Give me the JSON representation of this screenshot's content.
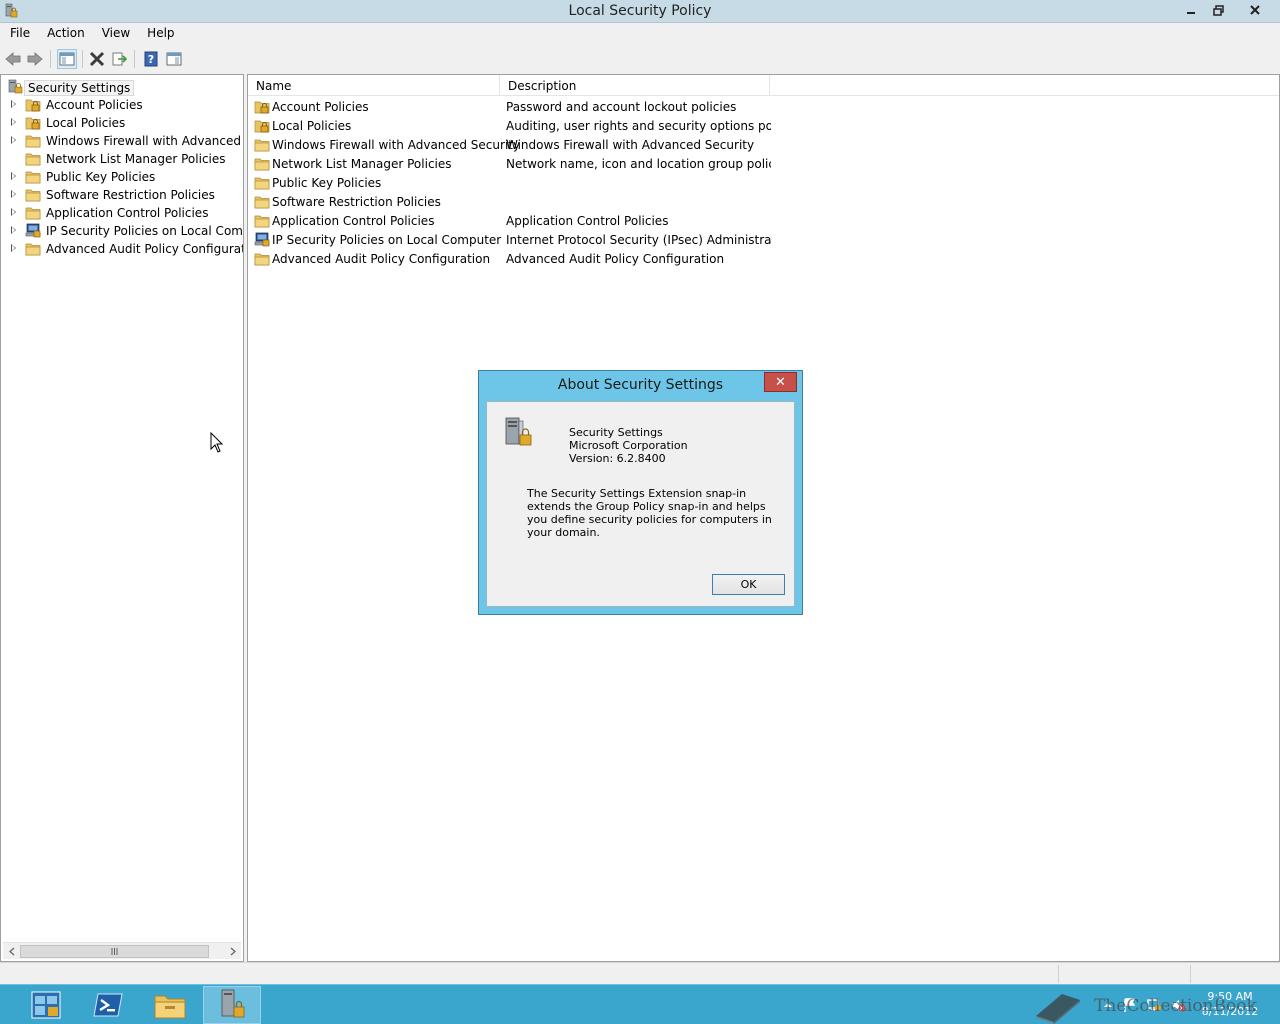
{
  "window": {
    "title": "Local Security Policy"
  },
  "menu": [
    {
      "label": "File"
    },
    {
      "label": "Action"
    },
    {
      "label": "View"
    },
    {
      "label": "Help"
    }
  ],
  "tree": {
    "root": "Security Settings",
    "items": [
      {
        "label": "Account Policies",
        "icon": "folder-lock-icon",
        "expandable": true
      },
      {
        "label": "Local Policies",
        "icon": "folder-lock-icon",
        "expandable": true
      },
      {
        "label": "Windows Firewall with Advanced Security",
        "icon": "folder-icon",
        "expandable": true
      },
      {
        "label": "Network List Manager Policies",
        "icon": "folder-icon",
        "expandable": false
      },
      {
        "label": "Public Key Policies",
        "icon": "folder-icon",
        "expandable": true
      },
      {
        "label": "Software Restriction Policies",
        "icon": "folder-icon",
        "expandable": true
      },
      {
        "label": "Application Control Policies",
        "icon": "folder-icon",
        "expandable": true
      },
      {
        "label": "IP Security Policies on Local Computer",
        "icon": "ipsec-icon",
        "expandable": true
      },
      {
        "label": "Advanced Audit Policy Configuration",
        "icon": "folder-icon",
        "expandable": true
      }
    ]
  },
  "list": {
    "columns": {
      "name": "Name",
      "description": "Description"
    },
    "rows": [
      {
        "name": "Account Policies",
        "description": "Password and account lockout policies",
        "icon": "folder-lock-icon"
      },
      {
        "name": "Local Policies",
        "description": "Auditing, user rights and security options polici...",
        "icon": "folder-lock-icon"
      },
      {
        "name": "Windows Firewall with Advanced Security",
        "description": "Windows Firewall with Advanced Security",
        "icon": "folder-icon"
      },
      {
        "name": "Network List Manager Policies",
        "description": "Network name, icon and location group policies.",
        "icon": "folder-icon"
      },
      {
        "name": "Public Key Policies",
        "description": "",
        "icon": "folder-icon"
      },
      {
        "name": "Software Restriction Policies",
        "description": "",
        "icon": "folder-icon"
      },
      {
        "name": "Application Control Policies",
        "description": "Application Control Policies",
        "icon": "folder-icon"
      },
      {
        "name": "IP Security Policies on Local Computer",
        "description": "Internet Protocol Security (IPsec) Administratio...",
        "icon": "ipsec-icon"
      },
      {
        "name": "Advanced Audit Policy Configuration",
        "description": "Advanced Audit Policy Configuration",
        "icon": "folder-icon"
      }
    ]
  },
  "dialog": {
    "title": "About Security Settings",
    "product": "Security Settings",
    "company": "Microsoft Corporation",
    "version": "Version: 6.2.8400",
    "description": "The Security Settings Extension snap-in extends the Group Policy snap-in and helps you define security policies for computers in your domain.",
    "ok_label": "OK",
    "close_glyph": "✕"
  },
  "taskbar": {
    "time": "9:50 AM",
    "date": "8/11/2012"
  },
  "watermark": {
    "text": "TheCollectionBook"
  },
  "colors": {
    "title_bar": "#c7dbe6",
    "dialog_frame": "#6dc6e7",
    "taskbar": "#3aa6ce",
    "close_button": "#c7504b"
  }
}
